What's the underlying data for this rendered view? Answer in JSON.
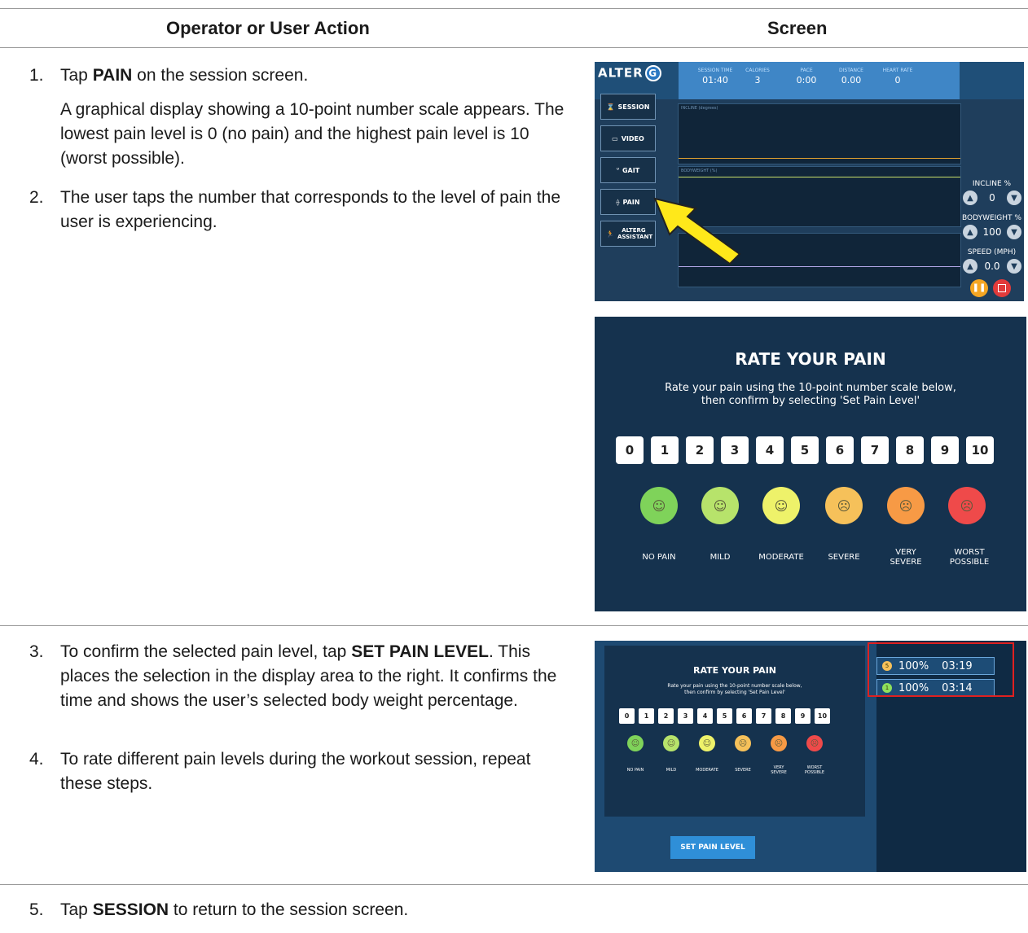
{
  "header": {
    "col_action": "Operator or User Action",
    "col_screen": "Screen"
  },
  "steps": [
    {
      "num": "1.",
      "pre": "Tap ",
      "bold": "PAIN",
      "post": " on the session screen.",
      "detail": "A graphical display showing a 10-point number scale appears. The lowest pain level is 0 (no pain) and the highest pain level is 10 (worst possible)."
    },
    {
      "num": "2.",
      "text": "The user taps the number that corresponds to the level of pain the user is experiencing."
    },
    {
      "num": "3.",
      "pre": "To confirm the selected pain level, tap ",
      "bold": "SET PAIN LEVEL",
      "post": ". This places the selection in the display area to the right. It confirms the time and shows the user’s selected body weight percentage."
    },
    {
      "num": "4.",
      "text": "To rate different pain levels during the workout session, repeat these steps."
    },
    {
      "num": "5.",
      "pre": "Tap ",
      "bold": "SESSION",
      "post": " to return to the session screen."
    }
  ],
  "session_screen": {
    "logo": "ALTER",
    "logo_mark": "G",
    "stats": [
      {
        "label": "SESSION TIME",
        "value": "01:40"
      },
      {
        "label": "CALORIES",
        "value": "3"
      },
      {
        "label": "PACE",
        "value": "0:00"
      },
      {
        "label": "DISTANCE",
        "value": "0.00"
      },
      {
        "label": "HEART RATE",
        "value": "0"
      }
    ],
    "nav": [
      "SESSION",
      "VIDEO",
      "GAIT",
      "PAIN",
      "ALTERG ASSISTANT"
    ],
    "graph_titles": [
      "INCLINE (degrees)",
      "BODYWEIGHT (%)",
      ""
    ],
    "controls": [
      {
        "label": "INCLINE %",
        "value": "0"
      },
      {
        "label": "BODYWEIGHT %",
        "value": "100"
      },
      {
        "label": "SPEED (MPH)",
        "value": "0.0"
      }
    ],
    "accent": "#ffe81a"
  },
  "rate_screen": {
    "title": "RATE YOUR PAIN",
    "subtitle_1": "Rate your pain using the 10-point number scale below,",
    "subtitle_2": "then confirm by selecting 'Set Pain Level'",
    "numbers": [
      "0",
      "1",
      "2",
      "3",
      "4",
      "5",
      "6",
      "7",
      "8",
      "9",
      "10"
    ],
    "faces": [
      {
        "label": "NO PAIN",
        "color": "#7fd35a"
      },
      {
        "label": "MILD",
        "color": "#b7e36b"
      },
      {
        "label": "MODERATE",
        "color": "#eef26a"
      },
      {
        "label": "SEVERE",
        "color": "#f6c15a"
      },
      {
        "label": "VERY SEVERE",
        "color": "#f79a45"
      },
      {
        "label": "WORST POSSIBLE",
        "color": "#ef4a4a"
      }
    ]
  },
  "confirm_screen": {
    "set_button": "SET PAIN LEVEL",
    "entries": [
      {
        "level": "5",
        "percent": "100%",
        "time": "03:19",
        "color": "#f6c15a"
      },
      {
        "level": "1",
        "percent": "100%",
        "time": "03:14",
        "color": "#8ee05c"
      }
    ]
  }
}
